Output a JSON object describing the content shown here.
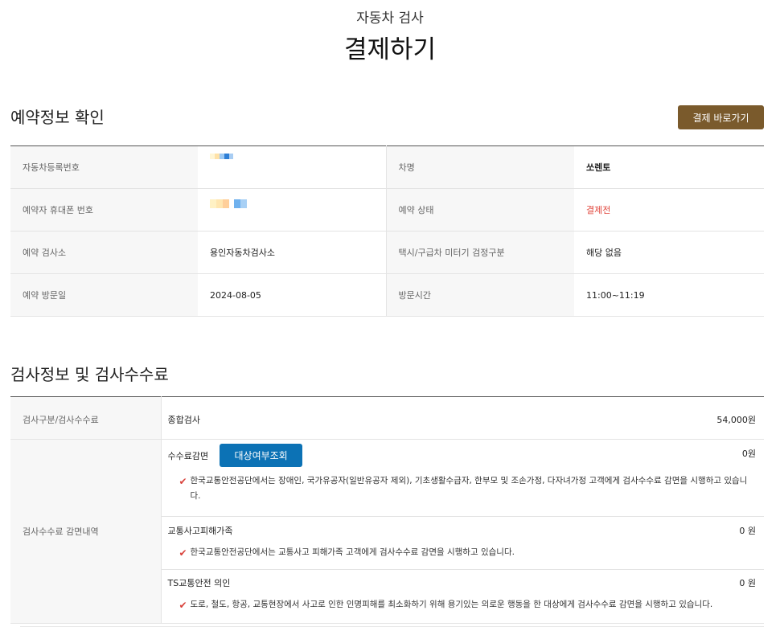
{
  "header": {
    "subtitle": "자동차 검사",
    "title": "결제하기"
  },
  "reservation": {
    "section_title": "예약정보 확인",
    "pay_button": "결제 바로가기",
    "rows": [
      {
        "l1": "자동차등록번호",
        "v1": "",
        "l2": "차명",
        "v2": "쏘렌토"
      },
      {
        "l1": "예약자 휴대폰 번호",
        "v1": "",
        "l2": "예약 상태",
        "v2": "결제전"
      },
      {
        "l1": "예약 검사소",
        "v1": "용인자동차검사소",
        "l2": "택시/구급차 미터기 검정구분",
        "v2": "해당 없음"
      },
      {
        "l1": "예약 방문일",
        "v1": "2024-08-05",
        "l2": "방문시간",
        "v2": "11:00~11:19"
      }
    ]
  },
  "fee": {
    "section_title": "검사정보 및 검사수수료",
    "type_label": "검사구분/검사수수료",
    "type_value": "종합검사",
    "type_fee": "54,000원",
    "discount_label": "검사수수료 감면내역",
    "items": [
      {
        "title": "수수료감면",
        "button": "대상여부조회",
        "amount": "0원",
        "note": "한국교통안전공단에서는 장애인, 국가유공자(일반유공자 제외), 기초생활수급자, 한부모 및 조손가정, 다자녀가정 고객에게 검사수수료 감면을 시행하고 있습니다."
      },
      {
        "title": "교통사고피해가족",
        "amount": "0 원",
        "note": "한국교통안전공단에서는 교통사고 피해가족 고객에게 검사수수료 감면을 시행하고 있습니다."
      },
      {
        "title": "TS교통안전 의인",
        "amount": "0 원",
        "note": "도로, 철도, 항공, 교통현장에서 사고로 인한 인명피해를 최소화하기 위해 용기있는 의로운 행동을 한 대상에게 검사수수료 감면을 시행하고 있습니다."
      }
    ]
  },
  "colors": {
    "accent_brown": "#7a5a2c",
    "accent_blue": "#0c72b5",
    "status_red": "#e0443a"
  }
}
